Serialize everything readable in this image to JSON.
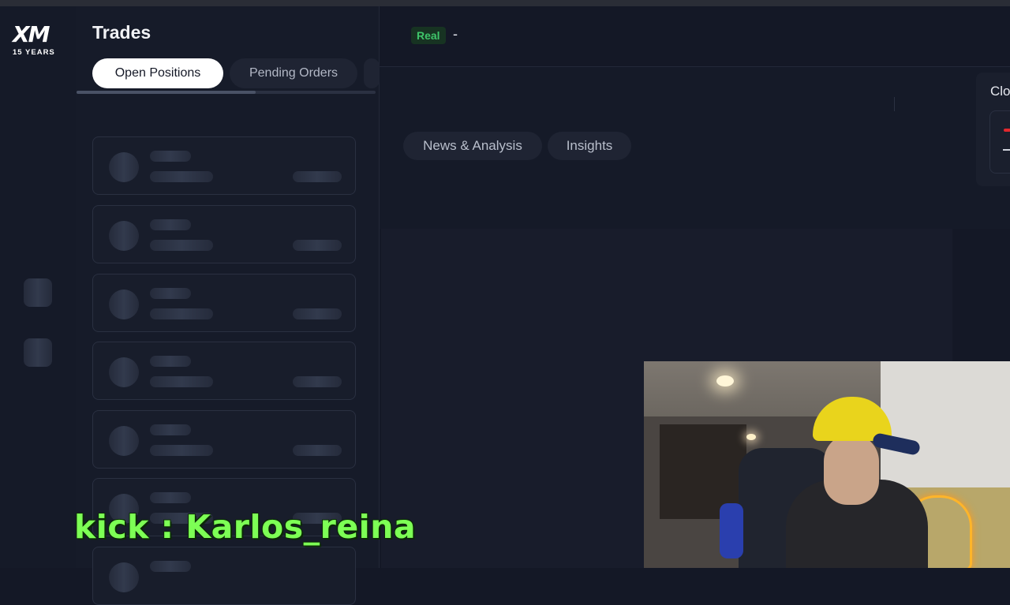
{
  "brand": {
    "logo_text": "XM",
    "logo_subtext": "15 YEARS"
  },
  "trades": {
    "title": "Trades",
    "tabs": [
      {
        "label": "Open Positions",
        "active": true
      },
      {
        "label": "Pending Orders",
        "active": false
      }
    ]
  },
  "header": {
    "account_badge": "Real",
    "account_value": "-"
  },
  "subnav": {
    "pills": [
      {
        "label": "News & Analysis"
      },
      {
        "label": "Insights"
      }
    ]
  },
  "right_panel": {
    "label": "Clo"
  },
  "overlay": {
    "kick_text": "kick : Karlos_reina"
  },
  "colors": {
    "background": "#141826",
    "badge_green": "#3fc56a",
    "kick_green": "#7dff55",
    "brand_red": "#e1282e"
  },
  "icons": [
    "xm-logo",
    "skeleton-icon"
  ]
}
